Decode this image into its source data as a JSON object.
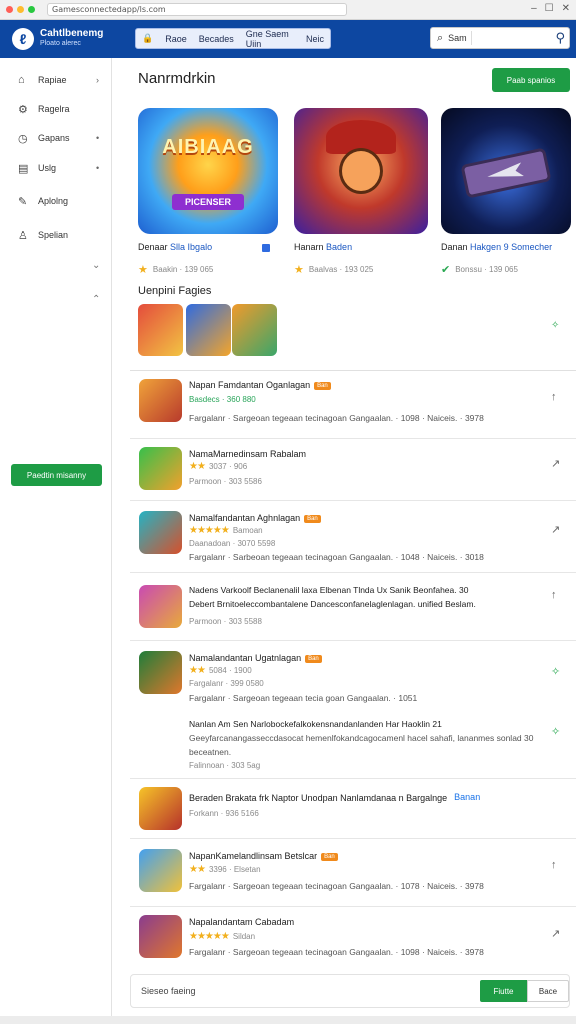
{
  "browser": {
    "url": "Gamesconnectedapp/ls.com"
  },
  "header": {
    "brand_title": "Cahtlbenemg",
    "brand_sub": "Ploato alerec",
    "tabs": [
      "Raoe",
      "Becades",
      "Gne Saem Uiin",
      "Neic"
    ],
    "search_label": "Sam"
  },
  "sidebar": {
    "items": [
      {
        "label": "Rapiae",
        "icon": "game-icon",
        "arrow": "›"
      },
      {
        "label": "Ragelra",
        "icon": "puzzle-icon",
        "arrow": ""
      },
      {
        "label": "Gapans",
        "icon": "clock-icon",
        "arrow": "•"
      },
      {
        "label": "Uslg",
        "icon": "calendar-icon",
        "arrow": "•"
      },
      {
        "label": "Aplolng",
        "icon": "pen-icon",
        "arrow": ""
      },
      {
        "label": "Spelian",
        "icon": "user-icon",
        "arrow": ""
      }
    ],
    "cta": "Paedtin misanny"
  },
  "main": {
    "title": "Nanrmdrkin",
    "top_cta": "Paab spanios",
    "featured": [
      {
        "art_title": "AIBIAAG",
        "art_sub": "PICENSER",
        "cap_a": "Denaar",
        "cap_b": "Slla Ibgalo",
        "meta": "Baakin · 139 065"
      },
      {
        "cap_a": "Hanarn",
        "cap_b": "Baden",
        "meta": "Baalvas · 193 025"
      },
      {
        "cap_a": "Danan",
        "cap_b": "Hakgen 9 Somecher",
        "meta": "Bonssu · 139 065"
      }
    ],
    "subsection": "Uenpini Fagies"
  },
  "list": [
    {
      "title": "Napan Famdantan Oganlagan",
      "badge": "Ban",
      "line2": "Basdecs · 360 880",
      "desc": "Fargalanr · Sargeoan tegeaan tecinagoan Gangaalan. · 1098 · Naiceis. · 3978",
      "action": "↑",
      "stars": "",
      "stars_txt": ""
    },
    {
      "title": "NamaMarnedinsam Rabalam",
      "badge": "",
      "stars": "★★",
      "stars_txt": "3037 · 906",
      "line3": "Parmoon · 303 5586",
      "action": "↗"
    },
    {
      "title": "Namalfandantan Aghnlagan",
      "badge": "Ban",
      "stars": "★★★★★",
      "stars_txt": "Bamoan",
      "line3": "Daanadoan · 3070 5598",
      "desc": "Fargalanr · Sarbeoan tegeaan tecinagoan Gangaalan. · 1048 · Naiceis. · 3018",
      "action": "↗"
    },
    {
      "title": "Nadens Varkoolf Beclanenalil laxa Elbenan Tlnda Ux Sanik Beonfahea. 30",
      "sub2": "Debert Brnitoeleccombantalene Dancesconfanelaglenlagan. unified Beslam.",
      "line3": "Parmoon · 303 5588",
      "action": "↑"
    },
    {
      "title": "Namalandantan Ugatnlagan",
      "badge": "Ban",
      "stars": "★★",
      "stars_txt": "5084 · 1900",
      "line3": "Fargalanr · 399 0580",
      "desc": "Fargalanr · Sargeoan tegeaan tecia goan Gangaalan. · 1051",
      "extra_title": "Nanlan Am Sen Narlobockefalkokensnandanlanden Har Haoklin 21",
      "extra_desc": "Geeyfarcanangasseccdasocat hemenlfokandcagocamenl hacel sahafi, lananmes sonlad 30 beceatnen.",
      "extra_meta": "Falinnoan · 303 5ag",
      "action": "↗"
    },
    {
      "title": "Beraden Brakata frk Naptor Unodpan Nanlamdanaa n Bargalnge",
      "badge": "Banan",
      "line3": "Forkann · 936 5166",
      "action": ""
    },
    {
      "title": "NapanKamelandlinsam Betslcar",
      "badge": "Ban",
      "stars": "★★",
      "stars_txt": "3396 · Elsetan",
      "desc": "Fargalanr · Sargeoan tegeaan tecinagoan Gangaalan. · 1078 · Naiceis. · 3978",
      "action": "↑"
    },
    {
      "title": "Napalandantam Cabadam",
      "badge": "",
      "stars": "★★★★★",
      "stars_txt": "Sildan",
      "desc": "Fargalanr · Sargeoan tegeaan tecinagoan Gangaalan. · 1098 · Naiceis. · 3978",
      "action": "↗"
    }
  ],
  "footer": {
    "label": "Sieseo faeing",
    "btn_primary": "Fiutte",
    "btn_secondary": "Bace"
  },
  "colors": {
    "header": "#0d47a1",
    "accent_green": "#1e9c45",
    "badge_orange": "#f08a1c",
    "star": "#f2b01e"
  }
}
